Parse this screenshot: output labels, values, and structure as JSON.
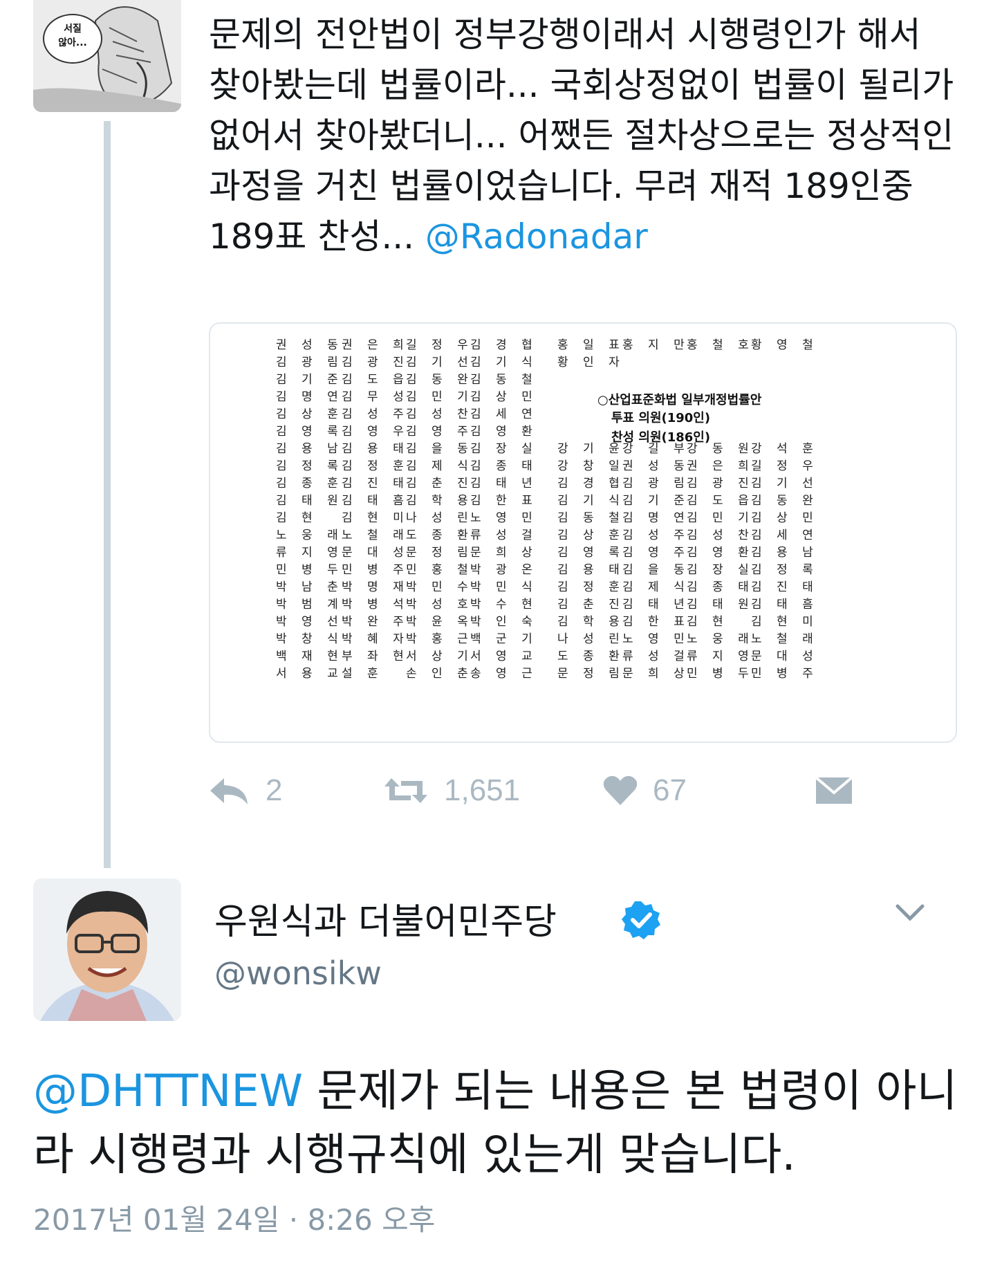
{
  "quoted_tweet": {
    "avatar_bubble_text": [
      "서질",
      "않아..."
    ],
    "text": "문제의 전안법이 정부강행이래서 시행령인가 해서 찾아봤는데 법률이라... 국회상정없이 법률이 될리가 없어서 찾아봤더니... 어쨌든 절차상으로는 정상적인 과정을 거친 법률이었습니다. 무려 재적 189인중 189표 찬성... ",
    "mention": "@Radonadar",
    "media": {
      "left_columns": [
        [
          "권 성 동",
          "김 광 림",
          "김 기 준",
          "김 명 연",
          "김 상 훈",
          "김 영 록",
          "김 용 남",
          "김 정 록",
          "김 종 훈",
          "김 태 원",
          "김    현",
          "노 웅 래",
          "류 지 영",
          "민 병 두",
          "박 남 춘",
          "박 범 계",
          "박 영 선",
          "박 창 식",
          "백 재 현",
          "서 용 교"
        ],
        [
          "권 은 희",
          "김 광 진",
          "김 도 읍",
          "김 무 성",
          "김 성 주",
          "김 영 우",
          "김 용 태",
          "김 정 훈",
          "김 진 태",
          "김 태 흠",
          "김 현 미",
          "노 철 래",
          "문 대 성",
          "민 병 주",
          "박 명 재",
          "박 병 석",
          "박 완 주",
          "박 혜 자",
          "부 좌 현",
          "설    훈"
        ],
        [
          "길 정 우",
          "김 기 선",
          "김 동 완",
          "김 민 기",
          "김 성 찬",
          "김 영 주",
          "김 을 동",
          "김 제 식",
          "김 춘 진",
          "김 학 용",
          "나 성 린",
          "도 종 환",
          "문 정 림",
          "민 홍 철",
          "박 민 수",
          "박 성 호",
          "박 윤 옥",
          "박 홍 근",
          "서 상 기",
          "손 인 춘"
        ],
        [
          "김 경 협",
          "김 기 식",
          "김 동 철",
          "김 상 민",
          "김 세 연",
          "김 영 환",
          "김 장 실",
          "김 종 태",
          "김 태 년",
          "김 한 표",
          "노 영 민",
          "류 성 걸",
          "문 희 상",
          "박 광 온",
          "박 민 식",
          "박 수 현",
          "박 인 숙",
          "백 군 기",
          "서 영 교",
          "송 영 근"
        ]
      ],
      "right_top": [
        "홍 일 표",
        "홍 지 만",
        "홍 철 호",
        "황 영 철",
        "황 인 자"
      ],
      "bill_title": "○산업표준화법 일부개정법률안",
      "vote_total": "투표 의원(190인)",
      "vote_yes": "찬성 의원(186인)",
      "right_rows": [
        [
          "강 기 윤",
          "강 길 부",
          "강 동 원",
          "강 석 훈"
        ],
        [
          "강 창 일",
          "권 성 동",
          "권 은 희",
          "길 정 우"
        ],
        [
          "김 경 협",
          "김 광 림",
          "김 광 진",
          "김 기 선"
        ],
        [
          "김 기 식",
          "김 기 준",
          "김 도 읍",
          "김 동 완"
        ],
        [
          "김 동 철",
          "김 명 연",
          "김 민 기",
          "김 상 민"
        ],
        [
          "김 상 훈",
          "김 성 주",
          "김 성 찬",
          "김 세 연"
        ],
        [
          "김 영 록",
          "김 영 주",
          "김 영 환",
          "김 용 남"
        ],
        [
          "김 용 태",
          "김 을 동",
          "김 장 실",
          "김 정 록"
        ],
        [
          "김 정 훈",
          "김 제 식",
          "김 종 태",
          "김 진 태"
        ],
        [
          "김 춘 진",
          "김 태 년",
          "김 태 원",
          "김 태 흠"
        ],
        [
          "김 학 용",
          "김 한 표",
          "김    현",
          "김 현 미"
        ],
        [
          "나 성 린",
          "노 영 민",
          "노 웅 래",
          "노 철 래"
        ],
        [
          "도 종 환",
          "류 성 걸",
          "류 지 영",
          "문 대 성"
        ],
        [
          "문 정 림",
          "문 희 상",
          "민 병 두",
          "민 병 주"
        ]
      ]
    },
    "actions": {
      "reply_count": "2",
      "retweet_count": "1,651",
      "like_count": "67"
    }
  },
  "reply_tweet": {
    "display_name": "우원식과 더불어민주당",
    "handle": "@wonsikw",
    "mention": "@DHTTNEW",
    "text": " 문제가 되는 내용은 본 법령이 아니라 시행령과 시행규칙에 있는게 맞습니다.",
    "timestamp": "2017년 01월 24일 · 8:26 오후"
  },
  "colors": {
    "link": "#1b95e0",
    "verified": "#1da1f2",
    "muted": "#aab8c2",
    "thread_line": "#ccd6dd"
  }
}
